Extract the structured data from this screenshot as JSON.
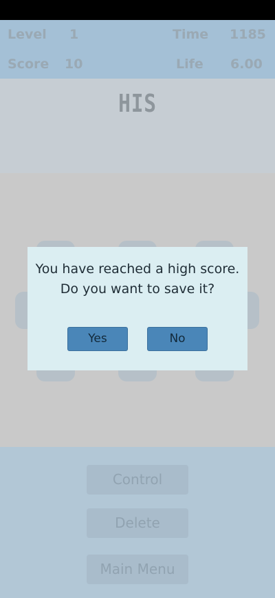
{
  "header": {
    "level_label": "Level",
    "level_value": "1",
    "time_label": "Time",
    "time_value": "1185",
    "score_label": "Score",
    "score_value": "10",
    "life_label": "Life",
    "life_value": "6.00"
  },
  "word": {
    "text": "HIS"
  },
  "keypad": {
    "keys": [
      "",
      "",
      "",
      "",
      "",
      "",
      "",
      ""
    ]
  },
  "menu": {
    "control_label": "Control",
    "delete_label": "Delete",
    "main_menu_label": "Main Menu"
  },
  "dialog": {
    "line1": "You have reached a high score.",
    "line2": "Do you want to save it?",
    "yes_label": "Yes",
    "no_label": "No"
  },
  "colors": {
    "header_bg": "#a4c0d6",
    "dialog_bg": "#dbeef2",
    "dialog_button": "#4a86b8",
    "keypad_bg": "#c9c9c9"
  }
}
